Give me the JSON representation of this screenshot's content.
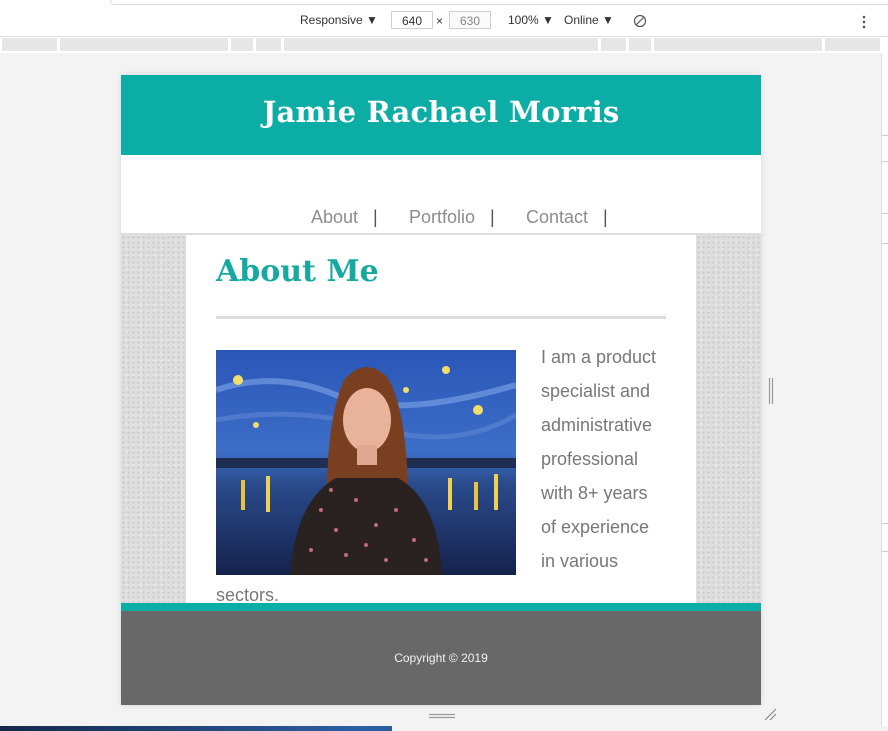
{
  "devtools": {
    "device": "Responsive ▼",
    "width": "640",
    "times": "×",
    "height": "630",
    "zoom": "100% ▼",
    "network": "Online ▼"
  },
  "site": {
    "title": "Jamie Rachael Morris",
    "nav": [
      {
        "label": "About",
        "sep": "|"
      },
      {
        "label": "Portfolio",
        "sep": "|"
      },
      {
        "label": "Contact",
        "sep": "|"
      }
    ],
    "heading": "About Me",
    "bio_lines": [
      "I am a product",
      "specialist and",
      "administrative",
      "professional",
      "with 8+ years",
      "of experience",
      "in various",
      "sectors."
    ],
    "footer": "Copyright © 2019",
    "colors": {
      "accent": "#0cada5",
      "heading": "#15a9a0",
      "footer": "#686868"
    }
  }
}
